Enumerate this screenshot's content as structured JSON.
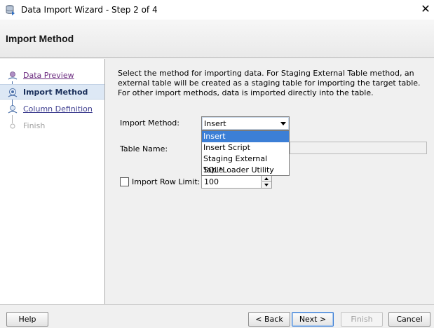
{
  "window": {
    "title": "Data Import Wizard - Step 2 of 4",
    "close_glyph": "✕"
  },
  "header": {
    "title": "Import Method"
  },
  "steps": [
    {
      "label": "Data Preview",
      "state": "visited"
    },
    {
      "label": "Import Method",
      "state": "current"
    },
    {
      "label": "Column Definition",
      "state": "link"
    },
    {
      "label": "Finish",
      "state": "disabled"
    }
  ],
  "main": {
    "description": "Select the method for importing data.  For Staging External Table method, an external table will be created as a staging table for importing the target table.  For other import methods, data is imported directly into the table.",
    "import_method": {
      "label": "Import Method:",
      "value": "Insert",
      "options": [
        "Insert",
        "Insert Script",
        "Staging External Table",
        "SQL*Loader Utility"
      ]
    },
    "table_name": {
      "label": "Table Name:",
      "value": ""
    },
    "row_limit": {
      "checkbox_label": "Import Row Limit:",
      "checked": false,
      "value": "100"
    }
  },
  "footer": {
    "help": "Help",
    "back": "< Back",
    "next": "Next >",
    "finish": "Finish",
    "cancel": "Cancel"
  },
  "colors": {
    "selection": "#3c7fd6",
    "current_step_bg": "#dde8f5",
    "link": "#3d3d8f"
  }
}
